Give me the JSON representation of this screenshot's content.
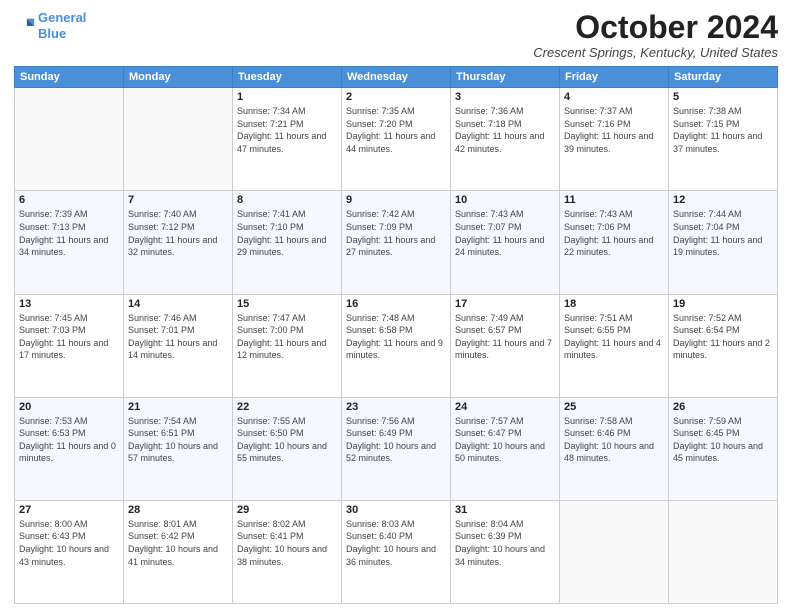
{
  "logo": {
    "line1": "General",
    "line2": "Blue"
  },
  "title": "October 2024",
  "location": "Crescent Springs, Kentucky, United States",
  "days_of_week": [
    "Sunday",
    "Monday",
    "Tuesday",
    "Wednesday",
    "Thursday",
    "Friday",
    "Saturday"
  ],
  "weeks": [
    [
      {
        "day": "",
        "info": ""
      },
      {
        "day": "",
        "info": ""
      },
      {
        "day": "1",
        "info": "Sunrise: 7:34 AM\nSunset: 7:21 PM\nDaylight: 11 hours and 47 minutes."
      },
      {
        "day": "2",
        "info": "Sunrise: 7:35 AM\nSunset: 7:20 PM\nDaylight: 11 hours and 44 minutes."
      },
      {
        "day": "3",
        "info": "Sunrise: 7:36 AM\nSunset: 7:18 PM\nDaylight: 11 hours and 42 minutes."
      },
      {
        "day": "4",
        "info": "Sunrise: 7:37 AM\nSunset: 7:16 PM\nDaylight: 11 hours and 39 minutes."
      },
      {
        "day": "5",
        "info": "Sunrise: 7:38 AM\nSunset: 7:15 PM\nDaylight: 11 hours and 37 minutes."
      }
    ],
    [
      {
        "day": "6",
        "info": "Sunrise: 7:39 AM\nSunset: 7:13 PM\nDaylight: 11 hours and 34 minutes."
      },
      {
        "day": "7",
        "info": "Sunrise: 7:40 AM\nSunset: 7:12 PM\nDaylight: 11 hours and 32 minutes."
      },
      {
        "day": "8",
        "info": "Sunrise: 7:41 AM\nSunset: 7:10 PM\nDaylight: 11 hours and 29 minutes."
      },
      {
        "day": "9",
        "info": "Sunrise: 7:42 AM\nSunset: 7:09 PM\nDaylight: 11 hours and 27 minutes."
      },
      {
        "day": "10",
        "info": "Sunrise: 7:43 AM\nSunset: 7:07 PM\nDaylight: 11 hours and 24 minutes."
      },
      {
        "day": "11",
        "info": "Sunrise: 7:43 AM\nSunset: 7:06 PM\nDaylight: 11 hours and 22 minutes."
      },
      {
        "day": "12",
        "info": "Sunrise: 7:44 AM\nSunset: 7:04 PM\nDaylight: 11 hours and 19 minutes."
      }
    ],
    [
      {
        "day": "13",
        "info": "Sunrise: 7:45 AM\nSunset: 7:03 PM\nDaylight: 11 hours and 17 minutes."
      },
      {
        "day": "14",
        "info": "Sunrise: 7:46 AM\nSunset: 7:01 PM\nDaylight: 11 hours and 14 minutes."
      },
      {
        "day": "15",
        "info": "Sunrise: 7:47 AM\nSunset: 7:00 PM\nDaylight: 11 hours and 12 minutes."
      },
      {
        "day": "16",
        "info": "Sunrise: 7:48 AM\nSunset: 6:58 PM\nDaylight: 11 hours and 9 minutes."
      },
      {
        "day": "17",
        "info": "Sunrise: 7:49 AM\nSunset: 6:57 PM\nDaylight: 11 hours and 7 minutes."
      },
      {
        "day": "18",
        "info": "Sunrise: 7:51 AM\nSunset: 6:55 PM\nDaylight: 11 hours and 4 minutes."
      },
      {
        "day": "19",
        "info": "Sunrise: 7:52 AM\nSunset: 6:54 PM\nDaylight: 11 hours and 2 minutes."
      }
    ],
    [
      {
        "day": "20",
        "info": "Sunrise: 7:53 AM\nSunset: 6:53 PM\nDaylight: 11 hours and 0 minutes."
      },
      {
        "day": "21",
        "info": "Sunrise: 7:54 AM\nSunset: 6:51 PM\nDaylight: 10 hours and 57 minutes."
      },
      {
        "day": "22",
        "info": "Sunrise: 7:55 AM\nSunset: 6:50 PM\nDaylight: 10 hours and 55 minutes."
      },
      {
        "day": "23",
        "info": "Sunrise: 7:56 AM\nSunset: 6:49 PM\nDaylight: 10 hours and 52 minutes."
      },
      {
        "day": "24",
        "info": "Sunrise: 7:57 AM\nSunset: 6:47 PM\nDaylight: 10 hours and 50 minutes."
      },
      {
        "day": "25",
        "info": "Sunrise: 7:58 AM\nSunset: 6:46 PM\nDaylight: 10 hours and 48 minutes."
      },
      {
        "day": "26",
        "info": "Sunrise: 7:59 AM\nSunset: 6:45 PM\nDaylight: 10 hours and 45 minutes."
      }
    ],
    [
      {
        "day": "27",
        "info": "Sunrise: 8:00 AM\nSunset: 6:43 PM\nDaylight: 10 hours and 43 minutes."
      },
      {
        "day": "28",
        "info": "Sunrise: 8:01 AM\nSunset: 6:42 PM\nDaylight: 10 hours and 41 minutes."
      },
      {
        "day": "29",
        "info": "Sunrise: 8:02 AM\nSunset: 6:41 PM\nDaylight: 10 hours and 38 minutes."
      },
      {
        "day": "30",
        "info": "Sunrise: 8:03 AM\nSunset: 6:40 PM\nDaylight: 10 hours and 36 minutes."
      },
      {
        "day": "31",
        "info": "Sunrise: 8:04 AM\nSunset: 6:39 PM\nDaylight: 10 hours and 34 minutes."
      },
      {
        "day": "",
        "info": ""
      },
      {
        "day": "",
        "info": ""
      }
    ]
  ]
}
